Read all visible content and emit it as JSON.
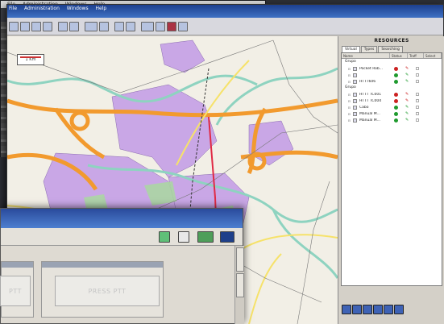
{
  "back_window": {
    "menus": [
      "File",
      "Administration",
      "Windows",
      "Help"
    ]
  },
  "main_window": {
    "menus": [
      "File",
      "Administration",
      "Windows",
      "Help"
    ],
    "map": {
      "scale_label": "1 Km"
    },
    "resources": {
      "title": "RESOURCES",
      "tabs": [
        {
          "label": "Virtual",
          "active": true
        },
        {
          "label": "Types",
          "active": false
        },
        {
          "label": "Searching",
          "active": false
        }
      ],
      "columns": [
        "Name",
        "Status",
        "Traff",
        "Select"
      ],
      "groups": [
        {
          "label": "Grupo",
          "rows": [
            {
              "name": "Pocket Rob...",
              "status_color": "#cc2222",
              "highlight": false
            },
            {
              "name": "",
              "status_color": "#1f9a2e",
              "highlight": true
            },
            {
              "name": "HTTT606",
              "status_color": "#1f9a2e",
              "highlight": false
            }
          ]
        },
        {
          "label": "Grupo",
          "rows": [
            {
              "name": "HTTT TC001",
              "status_color": "#cc2222",
              "highlight": false
            },
            {
              "name": "HTTT TC004",
              "status_color": "#cc2222",
              "highlight": false
            },
            {
              "name": "Cabo",
              "status_color": "#1f9a2e",
              "highlight": false
            },
            {
              "name": "Manual M...",
              "status_color": "#1f9a2e",
              "highlight": false
            },
            {
              "name": "Manual M...",
              "status_color": "#1f9a2e",
              "highlight": false
            }
          ]
        }
      ]
    }
  },
  "ptt_window": {
    "button_left": "PTT",
    "button_right": "PRESS PTT"
  },
  "colors": {
    "title_blue": "#2a4b9c",
    "status_red": "#cc2222",
    "status_green": "#1f9a2e",
    "road_orange": "#f29a2e",
    "river_green": "#8ed3c0",
    "urban_purple": "#c9a7e6"
  }
}
